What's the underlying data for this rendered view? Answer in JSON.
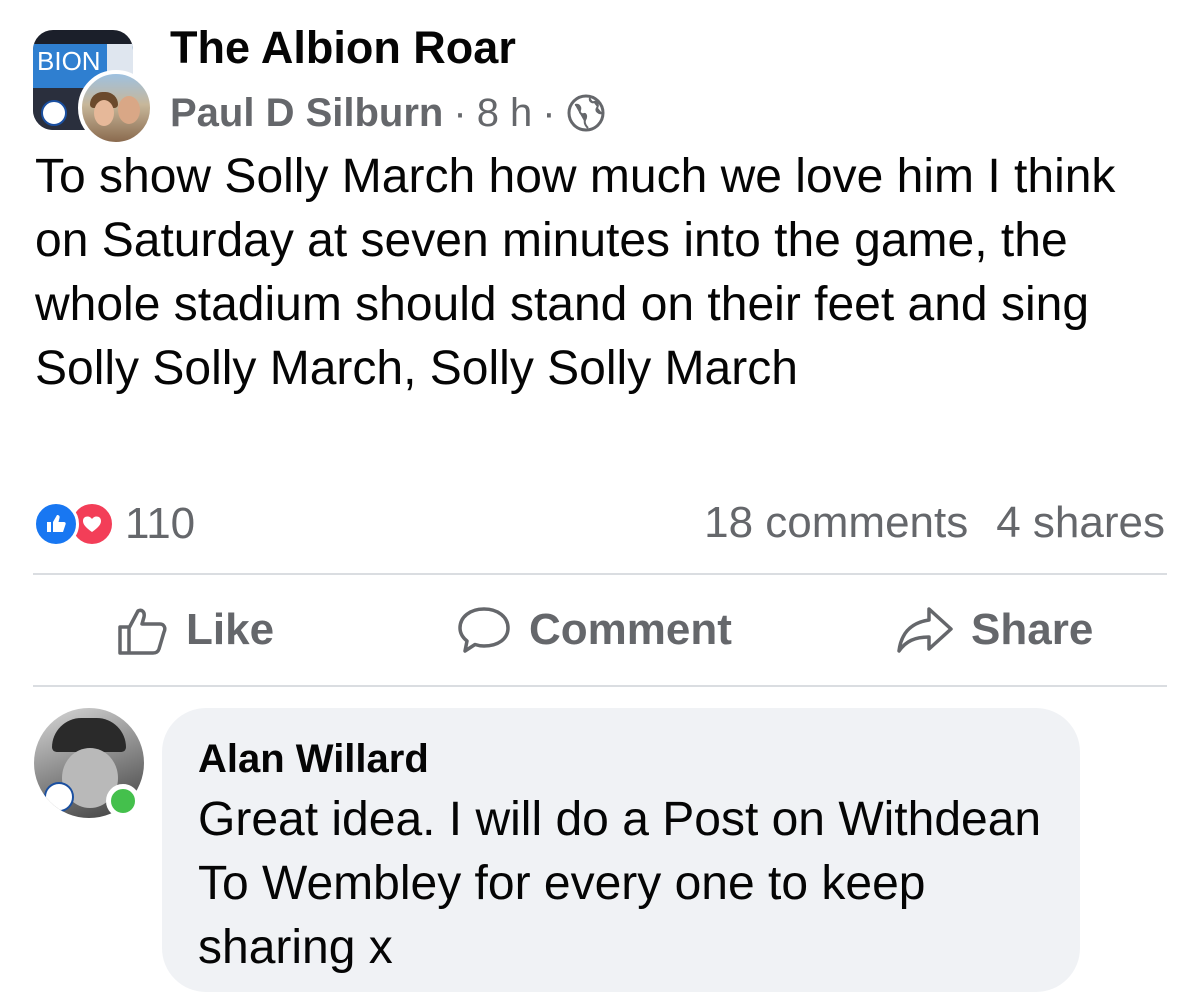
{
  "post": {
    "group_name": "The Albion Roar",
    "group_avatar_text": "BION",
    "author": "Paul D Silburn",
    "separator": "·",
    "time": "8 h",
    "privacy_icon": "globe-icon",
    "text": "To show Solly March how much we love him I think on Saturday at seven minutes into the game, the whole stadium should stand on their feet and sing Solly Solly March, Solly Solly March"
  },
  "stats": {
    "reaction_icons": [
      "like-icon",
      "love-icon"
    ],
    "reaction_count": "110",
    "comments": "18 comments",
    "shares": "4 shares"
  },
  "actions": {
    "like": "Like",
    "comment": "Comment",
    "share": "Share"
  },
  "comment": {
    "author": "Alan Willard",
    "text": "Great idea. I will do a Post on Withdean To Wembley for every one to keep sharing x",
    "online": true
  },
  "colors": {
    "primary_text": "#050505",
    "secondary_text": "#65676b",
    "like_blue": "#1877f2",
    "love_red": "#f33e58",
    "bubble_bg": "#f0f2f5",
    "online_green": "#44c04c",
    "divider": "#dadde1"
  }
}
